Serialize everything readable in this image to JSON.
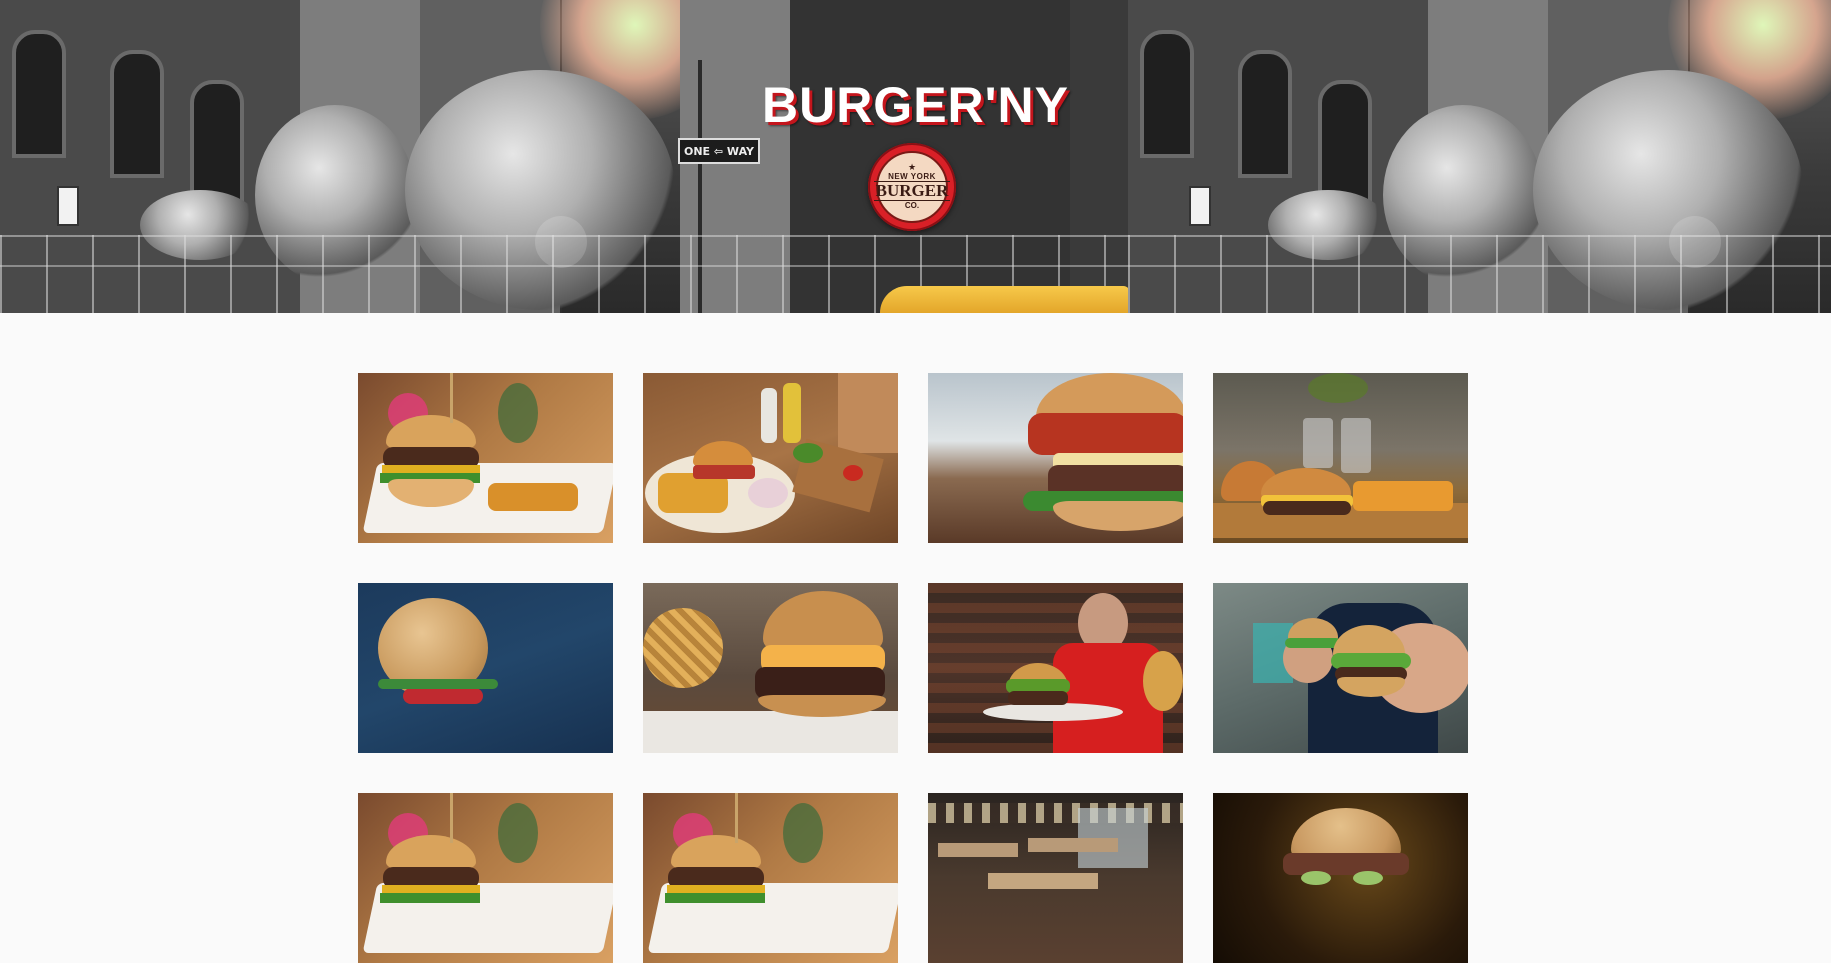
{
  "brand": {
    "title": "BURGER'NY",
    "logo": {
      "top_text": "NEW YORK",
      "main_text": "BURGER",
      "bottom_text": "CO.",
      "star": "★"
    }
  },
  "hero": {
    "street_sign": "ONE ⇦ WAY"
  },
  "colors": {
    "brand_red": "#d92027",
    "page_background": "#fafafa"
  },
  "gallery": {
    "tiles": [
      {
        "subject": "burger with fries on white plate"
      },
      {
        "subject": "burger with fries and coleslaw on board"
      },
      {
        "subject": "close-up bacon burger"
      },
      {
        "subject": "burgers with fries on wooden board"
      },
      {
        "subject": "sesame bun on blue background"
      },
      {
        "subject": "cheeseburger with waffle fries"
      },
      {
        "subject": "chef holding burger plate"
      },
      {
        "subject": "man holding burgers"
      },
      {
        "subject": "burger with fries on white plate"
      },
      {
        "subject": "burger with fries on white plate"
      },
      {
        "subject": "restaurant interior"
      },
      {
        "subject": "seeded bun sandwich on dark background"
      }
    ]
  }
}
